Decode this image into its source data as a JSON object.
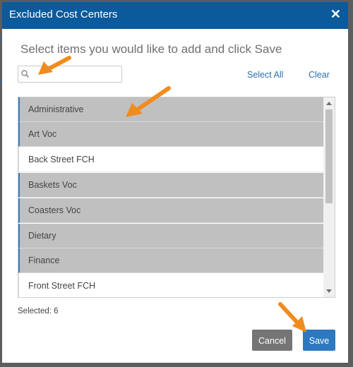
{
  "dialog": {
    "title": "Excluded Cost Centers",
    "close_glyph": "✕",
    "instructions": "Select items you would like to add and click Save"
  },
  "search": {
    "value": "",
    "placeholder": ""
  },
  "links": {
    "select_all": "Select All",
    "clear": "Clear"
  },
  "list": {
    "items": [
      {
        "label": "Administrative",
        "selected": true
      },
      {
        "label": "Art Voc",
        "selected": true
      },
      {
        "label": "Back Street FCH",
        "selected": false
      },
      {
        "label": "Baskets Voc",
        "selected": true
      },
      {
        "label": "Coasters Voc",
        "selected": true
      },
      {
        "label": "Dietary",
        "selected": true
      },
      {
        "label": "Finance",
        "selected": true
      },
      {
        "label": "Front Street FCH",
        "selected": false
      }
    ]
  },
  "footer": {
    "selected_text": "Selected: 6",
    "cancel_label": "Cancel",
    "save_label": "Save"
  },
  "colors": {
    "header": "#0a5a9c",
    "accent": "#2d6fae",
    "selected_row": "#c0c0c0",
    "annotation_arrow": "#f08c1e"
  }
}
